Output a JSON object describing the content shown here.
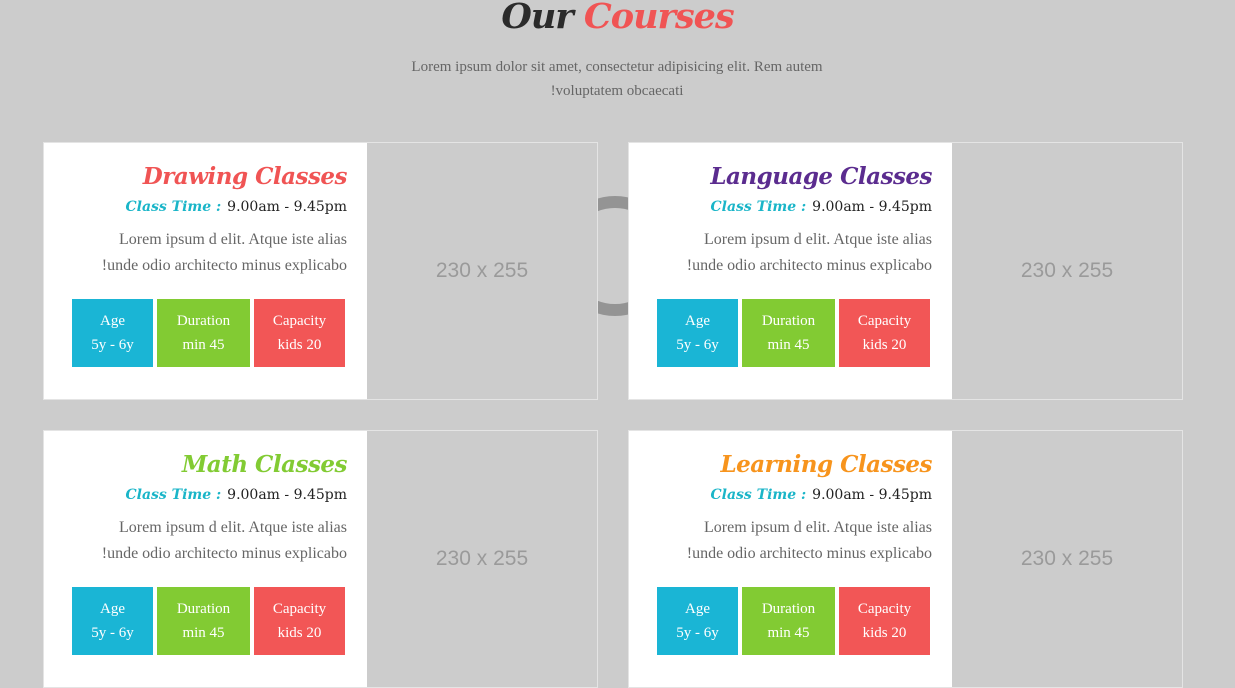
{
  "header": {
    "title_part1": "Our",
    "title_part2": "Courses",
    "subtitle_line1": "Lorem ipsum dolor sit amet, consectetur adipisicing elit. Rem autem",
    "subtitle_line2": "!voluptatem obcaecati"
  },
  "colors": {
    "accent_red": "#f05454",
    "cyan": "#1ab5d5",
    "green": "#82cb33",
    "red": "#f25656",
    "purple": "#5b2c8f",
    "lime": "#82cb33",
    "orange": "#f7941d"
  },
  "courses": [
    {
      "title": "Drawing Classes",
      "title_color": "#f05454",
      "time_label": "Class Time :",
      "time_value": "9.00am - 9.45pm",
      "desc_line1": "Lorem ipsum d elit. Atque iste alias",
      "desc_line2": "!unde odio architecto minus explicabo",
      "age_label": "Age",
      "age_value": "5y - 6y",
      "duration_label": "Duration",
      "duration_value": "min 45",
      "capacity_label": "Capacity",
      "capacity_value": "kids 20",
      "image_placeholder": "230 x 255"
    },
    {
      "title": "Language Classes",
      "title_color": "#5b2c8f",
      "time_label": "Class Time :",
      "time_value": "9.00am - 9.45pm",
      "desc_line1": "Lorem ipsum d elit. Atque iste alias",
      "desc_line2": "!unde odio architecto minus explicabo",
      "age_label": "Age",
      "age_value": "5y - 6y",
      "duration_label": "Duration",
      "duration_value": "min 45",
      "capacity_label": "Capacity",
      "capacity_value": "kids 20",
      "image_placeholder": "230 x 255"
    },
    {
      "title": "Math Classes",
      "title_color": "#82cb33",
      "time_label": "Class Time :",
      "time_value": "9.00am - 9.45pm",
      "desc_line1": "Lorem ipsum d elit. Atque iste alias",
      "desc_line2": "!unde odio architecto minus explicabo",
      "age_label": "Age",
      "age_value": "5y - 6y",
      "duration_label": "Duration",
      "duration_value": "min 45",
      "capacity_label": "Capacity",
      "capacity_value": "kids 20",
      "image_placeholder": "230 x 255"
    },
    {
      "title": "Learning Classes",
      "title_color": "#f7941d",
      "time_label": "Class Time :",
      "time_value": "9.00am - 9.45pm",
      "desc_line1": "Lorem ipsum d elit. Atque iste alias",
      "desc_line2": "!unde odio architecto minus explicabo",
      "age_label": "Age",
      "age_value": "5y - 6y",
      "duration_label": "Duration",
      "duration_value": "min 45",
      "capacity_label": "Capacity",
      "capacity_value": "kids 20",
      "image_placeholder": "230 x 255"
    }
  ]
}
